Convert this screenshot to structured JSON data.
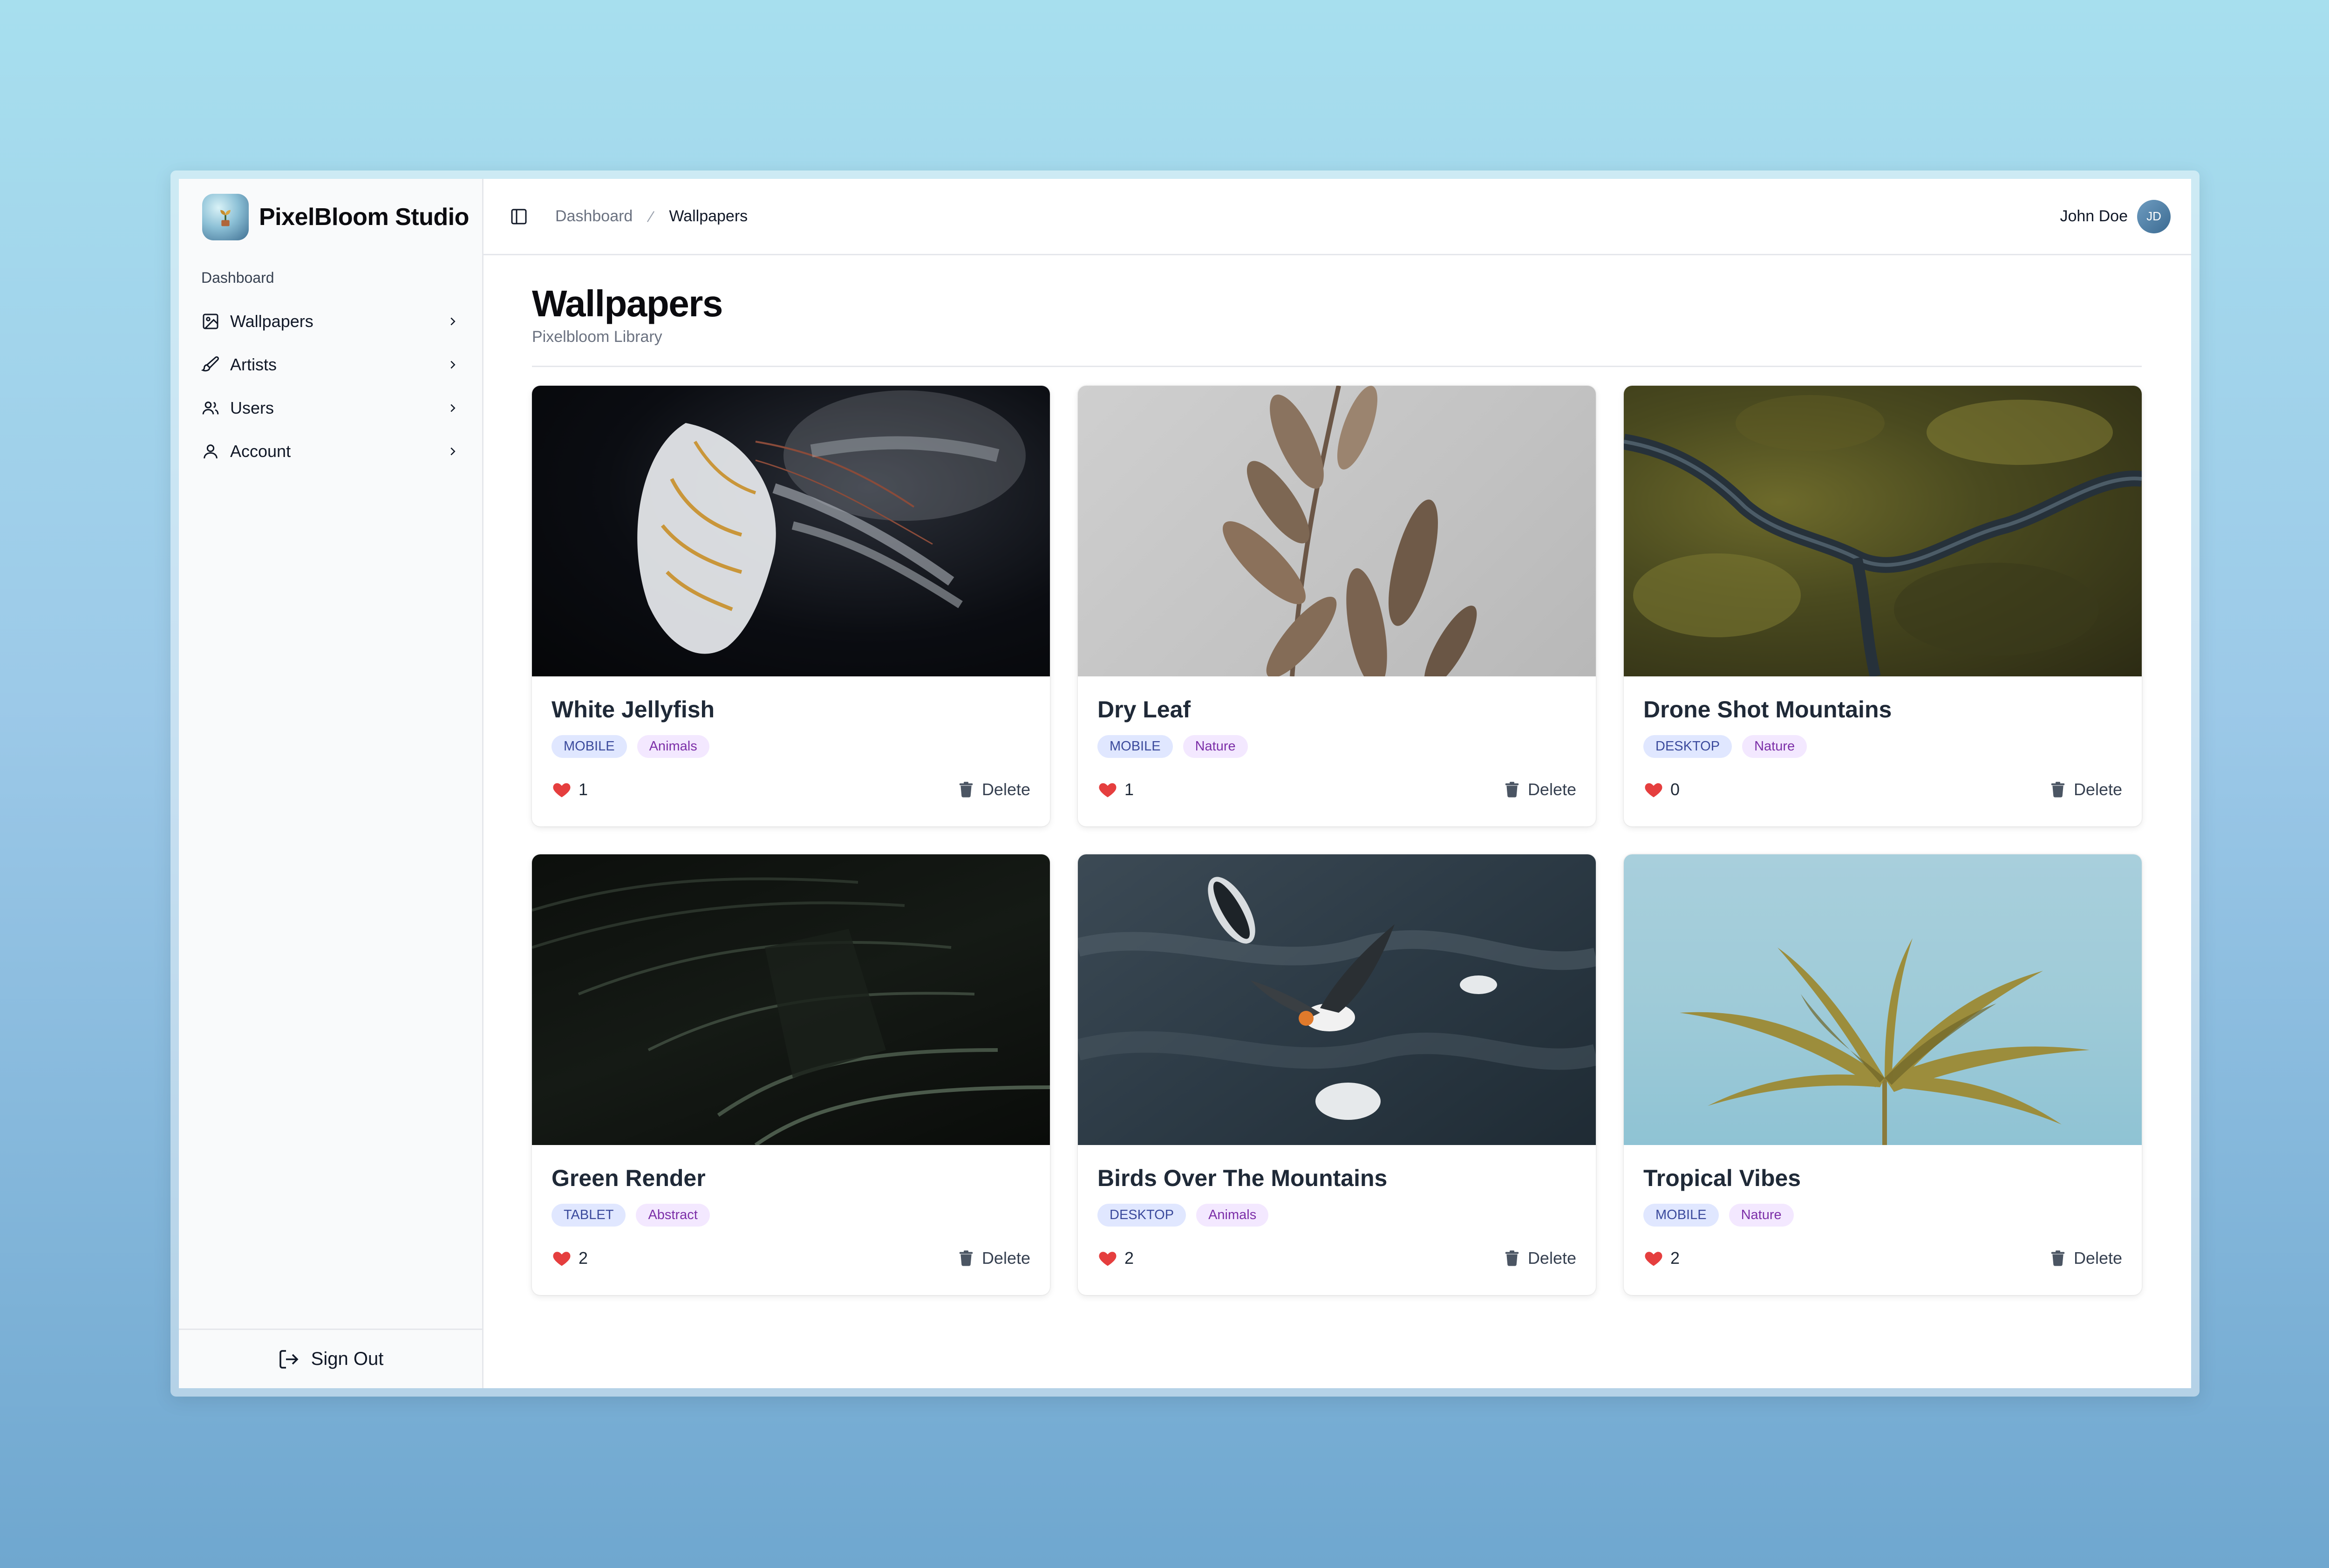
{
  "app": {
    "name": "PixelBloom Studio"
  },
  "sidebar": {
    "group_label": "Dashboard",
    "items": [
      {
        "label": "Wallpapers",
        "icon": "image-icon"
      },
      {
        "label": "Artists",
        "icon": "brush-icon"
      },
      {
        "label": "Users",
        "icon": "users-icon"
      },
      {
        "label": "Account",
        "icon": "user-icon"
      }
    ],
    "sign_out_label": "Sign Out"
  },
  "topbar": {
    "breadcrumb": [
      "Dashboard",
      "Wallpapers"
    ],
    "user_name": "John Doe",
    "user_initials": "JD"
  },
  "page": {
    "title": "Wallpapers",
    "subtitle": "Pixelbloom Library"
  },
  "wallpapers": [
    {
      "title": "White Jellyfish",
      "device": "MOBILE",
      "category": "Animals",
      "likes": "1",
      "delete_label": "Delete"
    },
    {
      "title": "Dry Leaf",
      "device": "MOBILE",
      "category": "Nature",
      "likes": "1",
      "delete_label": "Delete"
    },
    {
      "title": "Drone Shot Mountains",
      "device": "DESKTOP",
      "category": "Nature",
      "likes": "0",
      "delete_label": "Delete"
    },
    {
      "title": "Green Render",
      "device": "TABLET",
      "category": "Abstract",
      "likes": "2",
      "delete_label": "Delete"
    },
    {
      "title": "Birds Over The Mountains",
      "device": "DESKTOP",
      "category": "Animals",
      "likes": "2",
      "delete_label": "Delete"
    },
    {
      "title": "Tropical Vibes",
      "device": "MOBILE",
      "category": "Nature",
      "likes": "2",
      "delete_label": "Delete"
    }
  ],
  "colors": {
    "heart": "#e53e3e",
    "tag_device_bg": "#e0e7ff",
    "tag_category_bg": "#f3e8ff"
  }
}
